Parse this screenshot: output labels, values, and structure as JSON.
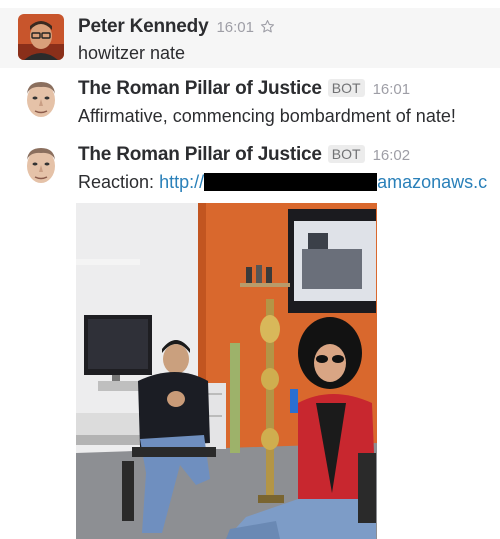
{
  "messages": [
    {
      "sender": "Peter Kennedy",
      "time": "16:01",
      "text": "howitzer nate",
      "icons": [
        "star-icon"
      ]
    },
    {
      "sender": "The Roman Pillar of Justice",
      "badge": "BOT",
      "time": "16:01",
      "text": "Affirmative, commencing bombardment of nate!"
    },
    {
      "sender": "The Roman Pillar of Justice",
      "badge": "BOT",
      "time": "16:02",
      "text_prefix": "Reaction:",
      "link_start": "http://",
      "link_end": "amazonaws.c",
      "attachment": {
        "type": "photo",
        "icon": "gif-image"
      }
    }
  ],
  "colors": {
    "link": "#2a80b9",
    "highlight_row": "#f6f6f6",
    "timestamp": "#9e9ea6"
  }
}
